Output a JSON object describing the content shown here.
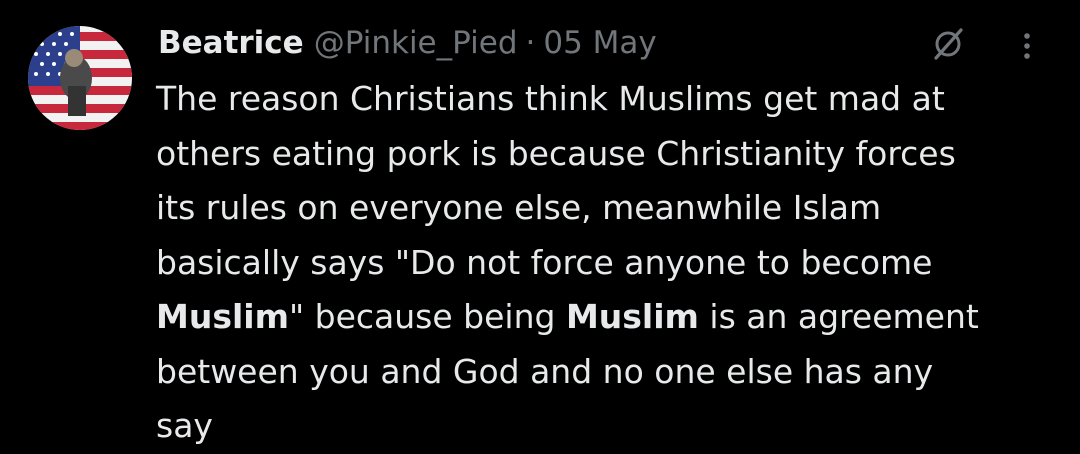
{
  "user": {
    "display_name": "Beatrice",
    "handle": "@Pinkie_Pied",
    "separator": "·",
    "date": "05 May"
  },
  "icons": {
    "grok": "grok-icon",
    "more": "more-options-icon",
    "avatar": "american-flag-avatar"
  },
  "colors": {
    "background": "#000000",
    "text": "#e7e9ea",
    "secondary": "#71767b"
  },
  "tweet": {
    "line1": "The reason Christians think Muslims get mad at",
    "line2": "others eating pork is because Christianity forces",
    "line3": "its rules on everyone else, meanwhile Islam",
    "line4": "basically says \"Do not force anyone to become",
    "line5_bold1": "Muslim",
    "line5_mid": "\" because being ",
    "line5_bold2": "Muslim",
    "line5_end": " is an agreement",
    "line6": "between you and God and no one else has any",
    "line7": "say"
  }
}
